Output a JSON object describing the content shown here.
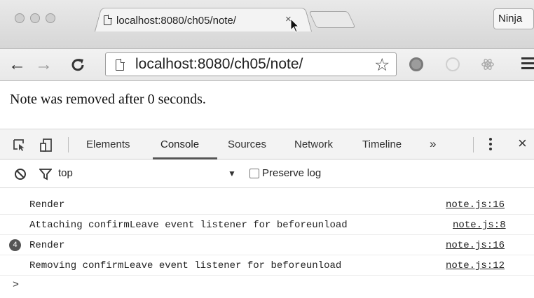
{
  "browser": {
    "tab_title": "localhost:8080/ch05/note/",
    "tab_close": "×",
    "profile": "Ninja",
    "url": "localhost:8080/ch05/note/"
  },
  "page": {
    "message": "Note was removed after 0 seconds."
  },
  "devtools": {
    "tabs": [
      "Elements",
      "Console",
      "Sources",
      "Network",
      "Timeline"
    ],
    "active_tab": "Console",
    "overflow": "»",
    "close": "×",
    "context": "top",
    "preserve_log": "Preserve log",
    "preserve_log_checked": false,
    "console_rows": [
      {
        "message": "Render",
        "source": "note.js:16",
        "count": ""
      },
      {
        "message": "Attaching confirmLeave event listener for beforeunload",
        "source": "note.js:8",
        "count": ""
      },
      {
        "message": "Render",
        "source": "note.js:16",
        "count": "4"
      },
      {
        "message": "Removing confirmLeave event listener for beforeunload",
        "source": "note.js:12",
        "count": ""
      }
    ],
    "prompt": ">"
  },
  "icons": [
    "back-arrow-icon",
    "forward-arrow-icon",
    "reload-icon",
    "page-icon",
    "star-icon",
    "extension-icon",
    "menu-icon",
    "inspect-icon",
    "device-icon",
    "kebab-icon",
    "block-icon",
    "filter-icon",
    "dropdown-arrow-icon",
    "cursor-icon"
  ]
}
